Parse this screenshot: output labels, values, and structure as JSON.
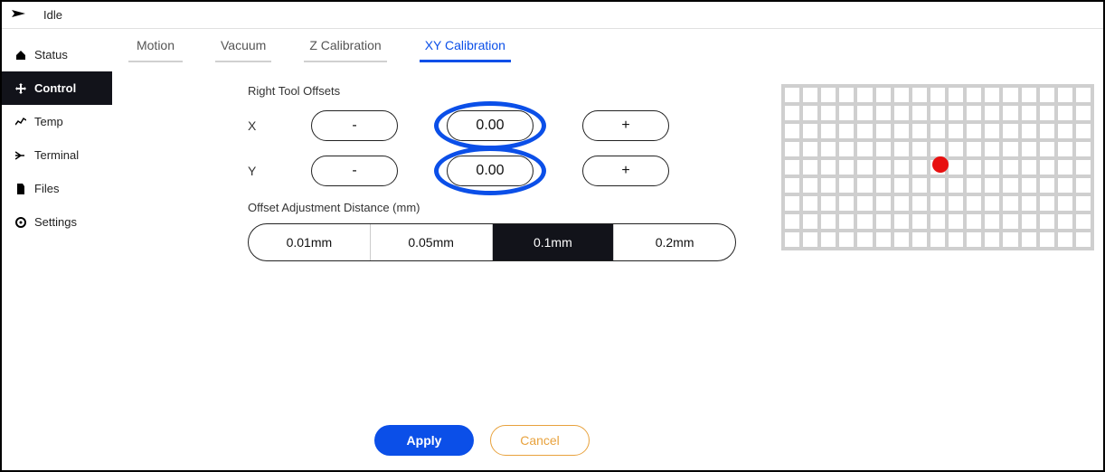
{
  "top": {
    "status": "Idle"
  },
  "sidebar": {
    "items": [
      {
        "label": "Status"
      },
      {
        "label": "Control"
      },
      {
        "label": "Temp"
      },
      {
        "label": "Terminal"
      },
      {
        "label": "Files"
      },
      {
        "label": "Settings"
      }
    ]
  },
  "tabs": [
    {
      "label": "Motion"
    },
    {
      "label": "Vacuum"
    },
    {
      "label": "Z Calibration"
    },
    {
      "label": "XY Calibration"
    }
  ],
  "calibration": {
    "section_title": "Right Tool Offsets",
    "x_label": "X",
    "y_label": "Y",
    "minus": "-",
    "plus": "+",
    "x_value": "0.00",
    "y_value": "0.00",
    "distance_label": "Offset Adjustment Distance (mm)",
    "distances": [
      "0.01mm",
      "0.05mm",
      "0.1mm",
      "0.2mm"
    ],
    "active_distance_index": 2
  },
  "footer": {
    "apply": "Apply",
    "cancel": "Cancel"
  }
}
